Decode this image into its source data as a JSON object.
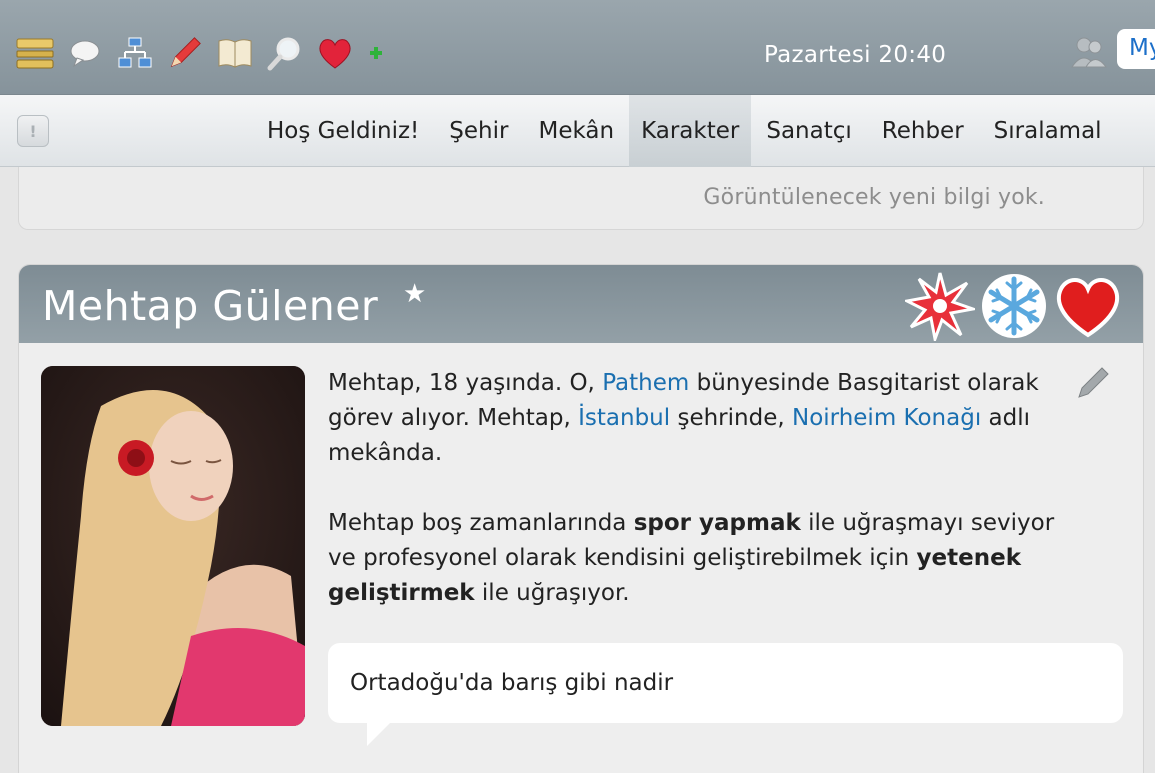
{
  "toolbar": {
    "icons": [
      "list-icon",
      "speech-bubble-icon",
      "hierarchy-icon",
      "pencil-icon",
      "book-icon",
      "magnifier-icon",
      "heart-icon",
      "plus-icon"
    ],
    "clock": "Pazartesi 20:40",
    "my_button_label": "My"
  },
  "nav": {
    "items": [
      {
        "label": "Hoş Geldiniz!"
      },
      {
        "label": "Şehir"
      },
      {
        "label": "Mekân"
      },
      {
        "label": "Karakter",
        "active": true
      },
      {
        "label": "Sanatçı"
      },
      {
        "label": "Rehber"
      },
      {
        "label": "Sıralamal"
      }
    ]
  },
  "news": {
    "text": "Görüntülenecek yeni bilgi yok."
  },
  "profile": {
    "name": "Mehtap Gülener",
    "star": "★",
    "badges": [
      "red-star-badge-icon",
      "snowflake-badge-icon",
      "heart-badge-icon"
    ],
    "bio1": {
      "t1": "Mehtap, 18 yaşında. O, ",
      "link_band": "Pathem",
      "t2": " bünyesinde Basgitarist olarak görev alıyor. Mehtap, ",
      "link_city": "İstanbul",
      "t3": " şehrinde, ",
      "link_venue": "Noirheim Konağı",
      "t4": " adlı mekânda."
    },
    "bio2": {
      "t1": "Mehtap boş zamanlarında ",
      "hobby": "spor yapmak",
      "t2": " ile uğraşmayı seviyor ve profesyonel olarak kendisini geliştirebilmek için ",
      "skill": "yetenek geliştirmek",
      "t3": " ile uğraşıyor."
    },
    "quote": "Ortadoğu'da barış gibi nadir"
  },
  "colors": {
    "topbar": "#8e9aa1",
    "link": "#1a6fb0",
    "card_header": "#85939a"
  }
}
